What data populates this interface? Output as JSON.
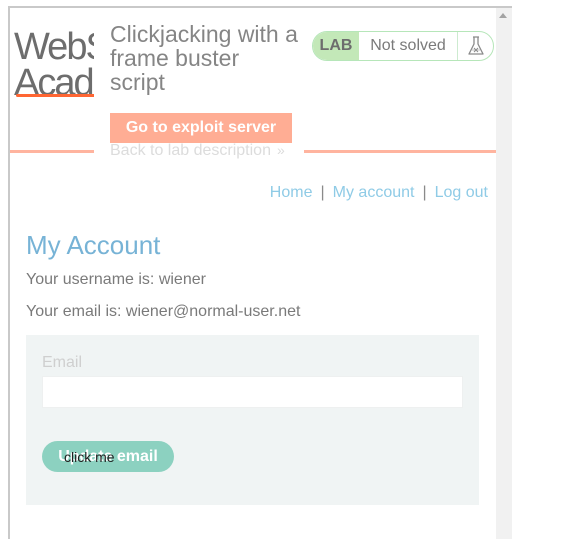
{
  "header": {
    "logo_line1": "WebSecurity",
    "logo_line2": "Academy",
    "lab_title": "Clickjacking with a frame buster script",
    "exploit_button_label": "Go to exploit server",
    "back_link_label": "Back to lab description",
    "back_link_arrow": "»",
    "lab_badge": "LAB",
    "status_text": "Not solved",
    "status_icon": "flask-icon",
    "accent_color": "#ff6633"
  },
  "nav": {
    "home_label": "Home",
    "account_label": "My account",
    "logout_label": "Log out",
    "separator": "|"
  },
  "account": {
    "title": "My Account",
    "username_line": "Your username is: wiener",
    "email_line": "Your email is: wiener@normal-user.net",
    "email_field_label": "Email",
    "email_field_value": "",
    "update_button_label": "Update email",
    "decoy_label": "click me"
  }
}
